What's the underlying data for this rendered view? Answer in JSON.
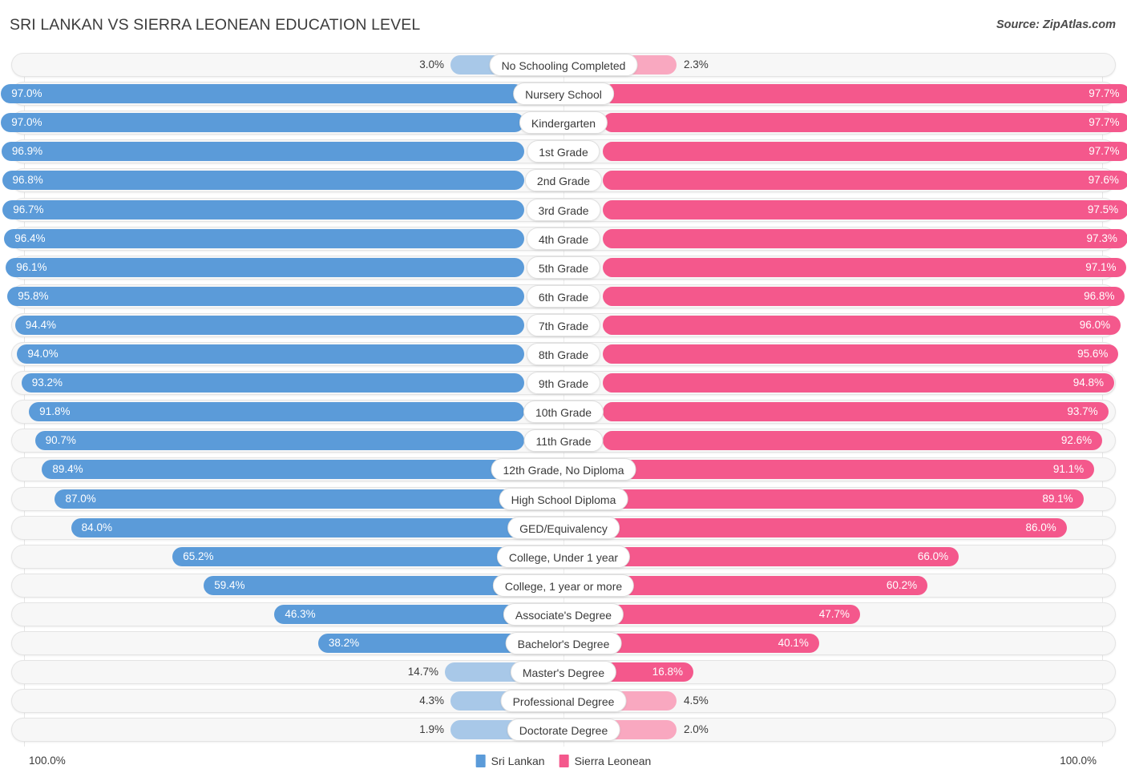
{
  "header": {
    "title": "SRI LANKAN VS SIERRA LEONEAN EDUCATION LEVEL",
    "source": "Source: ZipAtlas.com"
  },
  "footer": {
    "axis_left": "100.0%",
    "axis_right": "100.0%",
    "legend": [
      {
        "label": "Sri Lankan",
        "color": "#5b9bd9"
      },
      {
        "label": "Sierra Leonean",
        "color": "#f4588c"
      }
    ]
  },
  "colors": {
    "left_strong": "#5b9bd9",
    "left_light": "#a8c8e8",
    "right_strong": "#f4588c",
    "right_light": "#f9a8c0",
    "track": "#f7f7f7",
    "grid": "#e6e6e6"
  },
  "chart_data": {
    "type": "bar",
    "title": "SRI LANKAN VS SIERRA LEONEAN EDUCATION LEVEL",
    "orientation": "horizontal-diverging",
    "xlabel": "",
    "ylabel": "",
    "xlim": [
      0,
      100
    ],
    "grid": true,
    "legend_position": "bottom-center",
    "categories": [
      "No Schooling Completed",
      "Nursery School",
      "Kindergarten",
      "1st Grade",
      "2nd Grade",
      "3rd Grade",
      "4th Grade",
      "5th Grade",
      "6th Grade",
      "7th Grade",
      "8th Grade",
      "9th Grade",
      "10th Grade",
      "11th Grade",
      "12th Grade, No Diploma",
      "High School Diploma",
      "GED/Equivalency",
      "College, Under 1 year",
      "College, 1 year or more",
      "Associate's Degree",
      "Bachelor's Degree",
      "Master's Degree",
      "Professional Degree",
      "Doctorate Degree"
    ],
    "series": [
      {
        "name": "Sri Lankan",
        "color": "#5b9bd9",
        "values": [
          3.0,
          97.0,
          97.0,
          96.9,
          96.8,
          96.7,
          96.4,
          96.1,
          95.8,
          94.4,
          94.0,
          93.2,
          91.8,
          90.7,
          89.4,
          87.0,
          84.0,
          65.2,
          59.4,
          46.3,
          38.2,
          14.7,
          4.3,
          1.9
        ],
        "labels": [
          "3.0%",
          "97.0%",
          "97.0%",
          "96.9%",
          "96.8%",
          "96.7%",
          "96.4%",
          "96.1%",
          "95.8%",
          "94.4%",
          "94.0%",
          "93.2%",
          "91.8%",
          "90.7%",
          "89.4%",
          "87.0%",
          "84.0%",
          "65.2%",
          "59.4%",
          "46.3%",
          "38.2%",
          "14.7%",
          "4.3%",
          "1.9%"
        ]
      },
      {
        "name": "Sierra Leonean",
        "color": "#f4588c",
        "values": [
          2.3,
          97.7,
          97.7,
          97.7,
          97.6,
          97.5,
          97.3,
          97.1,
          96.8,
          96.0,
          95.6,
          94.8,
          93.7,
          92.6,
          91.1,
          89.1,
          86.0,
          66.0,
          60.2,
          47.7,
          40.1,
          16.8,
          4.5,
          2.0
        ],
        "labels": [
          "2.3%",
          "97.7%",
          "97.7%",
          "97.7%",
          "97.6%",
          "97.5%",
          "97.3%",
          "97.1%",
          "96.8%",
          "96.0%",
          "95.6%",
          "94.8%",
          "93.7%",
          "92.6%",
          "91.1%",
          "89.1%",
          "86.0%",
          "66.0%",
          "60.2%",
          "47.7%",
          "40.1%",
          "16.8%",
          "4.5%",
          "2.0%"
        ]
      }
    ]
  }
}
